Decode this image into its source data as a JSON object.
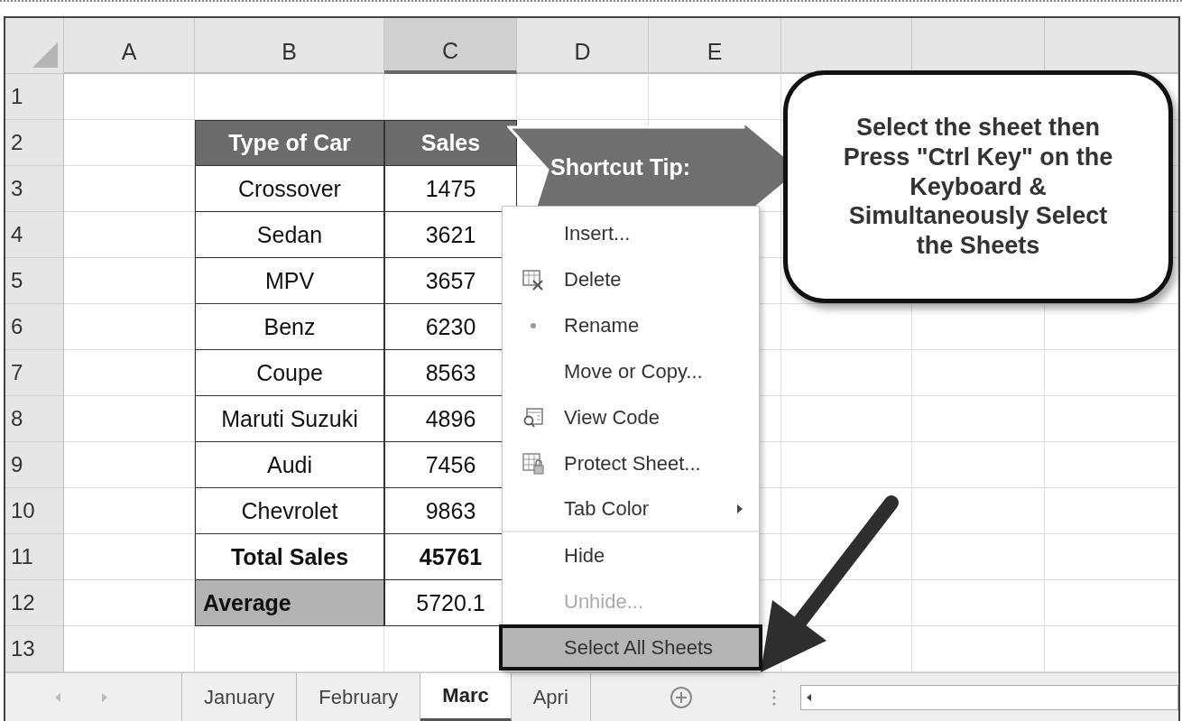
{
  "columns": [
    {
      "label": "A",
      "selected": false
    },
    {
      "label": "B",
      "selected": false
    },
    {
      "label": "C",
      "selected": true
    },
    {
      "label": "D",
      "selected": false
    },
    {
      "label": "E",
      "selected": false
    }
  ],
  "row_numbers": [
    "1",
    "2",
    "3",
    "4",
    "5",
    "6",
    "7",
    "8",
    "9",
    "10",
    "11",
    "12",
    "13"
  ],
  "table": {
    "headers": [
      "Type of Car",
      "Sales"
    ],
    "rows": [
      {
        "car": "Crossover",
        "sales": "1475"
      },
      {
        "car": "Sedan",
        "sales": "3621"
      },
      {
        "car": "MPV",
        "sales": "3657"
      },
      {
        "car": "Benz",
        "sales": "6230"
      },
      {
        "car": "Coupe",
        "sales": "8563"
      },
      {
        "car": "Maruti Suzuki",
        "sales": "4896"
      },
      {
        "car": "Audi",
        "sales": "7456"
      },
      {
        "car": "Chevrolet",
        "sales": "9863"
      }
    ],
    "total": {
      "label": "Total Sales",
      "value": "45761"
    },
    "average": {
      "label": "Average",
      "value": "5720.1"
    }
  },
  "shortcut_tip": "Shortcut Tip:",
  "callout": "Select the sheet then Press \"Ctrl Key\" on the Keyboard & Simultaneously Select the Sheets",
  "context_menu": [
    {
      "label": "Insert...",
      "disabled": false,
      "selected": false,
      "has_submenu": false,
      "separator_after": false
    },
    {
      "label": "Delete",
      "disabled": false,
      "selected": false,
      "has_submenu": false,
      "separator_after": false
    },
    {
      "label": "Rename",
      "disabled": false,
      "selected": false,
      "has_submenu": false,
      "separator_after": false
    },
    {
      "label": "Move or Copy...",
      "disabled": false,
      "selected": false,
      "has_submenu": false,
      "separator_after": false
    },
    {
      "label": "View Code",
      "disabled": false,
      "selected": false,
      "has_submenu": false,
      "separator_after": false
    },
    {
      "label": "Protect Sheet...",
      "disabled": false,
      "selected": false,
      "has_submenu": false,
      "separator_after": false
    },
    {
      "label": "Tab Color",
      "disabled": false,
      "selected": false,
      "has_submenu": true,
      "separator_after": true
    },
    {
      "label": "Hide",
      "disabled": false,
      "selected": false,
      "has_submenu": false,
      "separator_after": false
    },
    {
      "label": "Unhide...",
      "disabled": true,
      "selected": false,
      "has_submenu": false,
      "separator_after": false
    },
    {
      "label": "Select All Sheets",
      "disabled": false,
      "selected": true,
      "has_submenu": false,
      "separator_after": false
    }
  ],
  "sheet_tabs": [
    {
      "label": "January",
      "selected": false
    },
    {
      "label": "February",
      "selected": false
    },
    {
      "label": "Marc",
      "selected": true
    },
    {
      "label": "Apri",
      "selected": false
    }
  ]
}
